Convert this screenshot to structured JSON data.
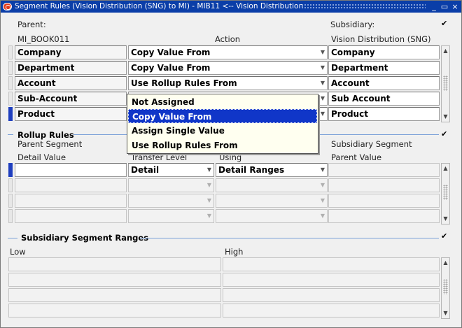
{
  "window": {
    "title": "Segment Rules (Vision Distribution (SNG) to MI) - MIB11 <-- Vision Distribution",
    "min": "_",
    "max": "▭",
    "close": "×"
  },
  "header": {
    "parent_label": "Parent:",
    "parent_value": "MI_BOOK011",
    "action_label": "Action",
    "subsidiary_label": "Subsidiary:",
    "subsidiary_value": "Vision Distribution (SNG)",
    "subsidiary_checked": "✔"
  },
  "segments": [
    {
      "parent": "Company",
      "action": "Copy Value From",
      "subsidiary": "Company"
    },
    {
      "parent": "Department",
      "action": "Copy Value From",
      "subsidiary": "Department"
    },
    {
      "parent": "Account",
      "action": "Use Rollup Rules From",
      "subsidiary": "Account"
    },
    {
      "parent": "Sub-Account",
      "action": "",
      "subsidiary": "Sub Account"
    },
    {
      "parent": "Product",
      "action": "",
      "subsidiary": "Product"
    }
  ],
  "dropdown": {
    "options": [
      "Not Assigned",
      "Copy Value From",
      "Assign Single Value",
      "Use Rollup Rules From"
    ],
    "selected": "Copy Value From"
  },
  "rollup": {
    "title": "Rollup Rules",
    "checked": "✔",
    "col_parent_1": "Parent Segment",
    "col_parent_2": "Detail Value",
    "col_transfer": "Transfer Level",
    "col_using": "Using",
    "col_sub_1": "Subsidiary Segment",
    "col_sub_2": "Parent Value",
    "row1_transfer": "Detail",
    "row1_using": "Detail Ranges"
  },
  "ranges": {
    "title": "Subsidiary Segment Ranges",
    "checked": "✔",
    "low_label": "Low",
    "high_label": "High"
  },
  "icons": {
    "window_icon": "oracle-icon",
    "scroll_up": "scroll-up-icon",
    "scroll_down": "scroll-down-icon",
    "dropdown": "chevron-down-icon"
  }
}
